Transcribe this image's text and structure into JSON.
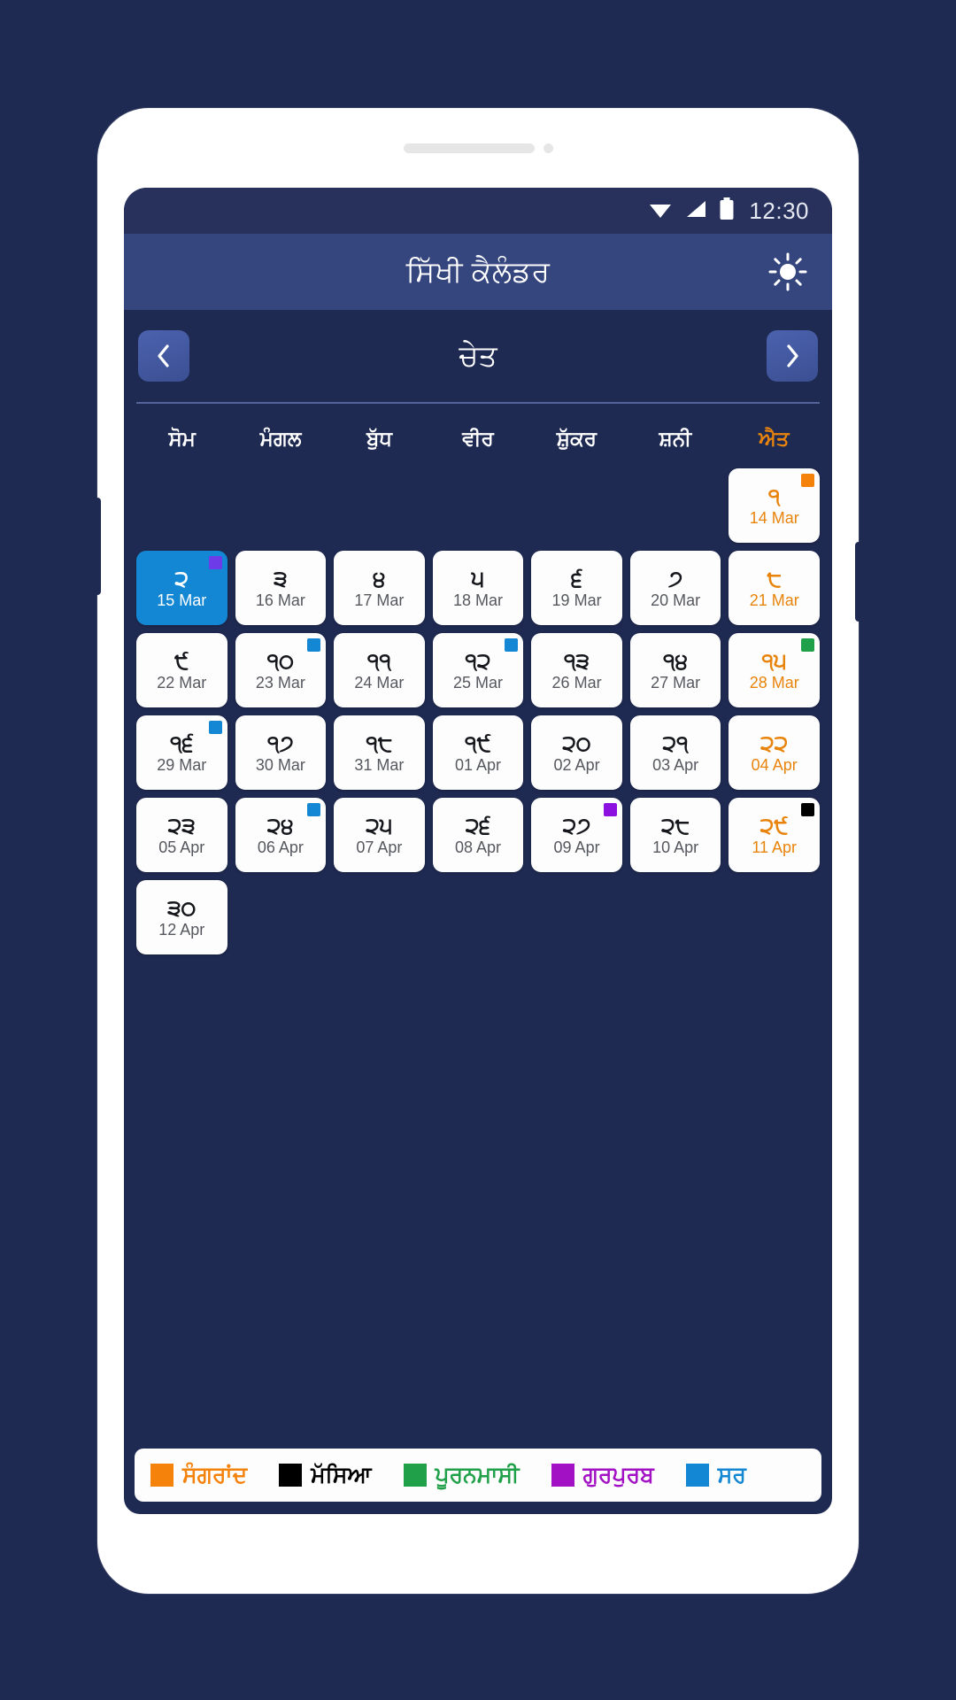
{
  "statusbar": {
    "time": "12:30",
    "icons": [
      "wifi-icon",
      "signal-icon",
      "battery-icon"
    ]
  },
  "appbar": {
    "title": "ਸਿੱਖੀ ਕੈਲੰਡਰ",
    "action_icon": "brightness-sun-icon"
  },
  "monthnav": {
    "prev_label": "‹",
    "next_label": "›",
    "month": "ਚੇਤ"
  },
  "weekdays": [
    {
      "label": "ਸੋਮ",
      "sunday": false
    },
    {
      "label": "ਮੰਗਲ",
      "sunday": false
    },
    {
      "label": "ਬੁੱਧ",
      "sunday": false
    },
    {
      "label": "ਵੀਰ",
      "sunday": false
    },
    {
      "label": "ਸ਼ੁੱਕਰ",
      "sunday": false
    },
    {
      "label": "ਸ਼ਨੀ",
      "sunday": false
    },
    {
      "label": "ਐਤ",
      "sunday": true
    }
  ],
  "colors": {
    "sangrand": "#F5820B",
    "massia": "#000000",
    "puranmashi": "#21A04A",
    "gurpurab": "#A211C4",
    "other": "#1387D3",
    "selected": "#1387D3",
    "screen_bg": "#1F2A52",
    "appbar_bg": "#35467F",
    "statusbar_bg": "#27315C"
  },
  "calendar": {
    "leading_blanks": 6,
    "days": [
      {
        "num": "੧",
        "sub": "14 Mar",
        "sunday": true,
        "selected": false,
        "badge": "#F5820B"
      },
      {
        "num": "੨",
        "sub": "15 Mar",
        "sunday": false,
        "selected": true,
        "badge": "#6E3BE8"
      },
      {
        "num": "੩",
        "sub": "16 Mar",
        "sunday": false,
        "selected": false,
        "badge": null
      },
      {
        "num": "੪",
        "sub": "17 Mar",
        "sunday": false,
        "selected": false,
        "badge": null
      },
      {
        "num": "੫",
        "sub": "18 Mar",
        "sunday": false,
        "selected": false,
        "badge": null
      },
      {
        "num": "੬",
        "sub": "19 Mar",
        "sunday": false,
        "selected": false,
        "badge": null
      },
      {
        "num": "੭",
        "sub": "20 Mar",
        "sunday": false,
        "selected": false,
        "badge": null
      },
      {
        "num": "੮",
        "sub": "21 Mar",
        "sunday": true,
        "selected": false,
        "badge": null
      },
      {
        "num": "੯",
        "sub": "22 Mar",
        "sunday": false,
        "selected": false,
        "badge": null
      },
      {
        "num": "੧੦",
        "sub": "23 Mar",
        "sunday": false,
        "selected": false,
        "badge": "#1387D3"
      },
      {
        "num": "੧੧",
        "sub": "24 Mar",
        "sunday": false,
        "selected": false,
        "badge": null
      },
      {
        "num": "੧੨",
        "sub": "25 Mar",
        "sunday": false,
        "selected": false,
        "badge": "#1387D3"
      },
      {
        "num": "੧੩",
        "sub": "26 Mar",
        "sunday": false,
        "selected": false,
        "badge": null
      },
      {
        "num": "੧੪",
        "sub": "27 Mar",
        "sunday": false,
        "selected": false,
        "badge": null
      },
      {
        "num": "੧੫",
        "sub": "28 Mar",
        "sunday": true,
        "selected": false,
        "badge": "#21A04A"
      },
      {
        "num": "੧੬",
        "sub": "29 Mar",
        "sunday": false,
        "selected": false,
        "badge": "#1387D3"
      },
      {
        "num": "੧੭",
        "sub": "30 Mar",
        "sunday": false,
        "selected": false,
        "badge": null
      },
      {
        "num": "੧੮",
        "sub": "31 Mar",
        "sunday": false,
        "selected": false,
        "badge": null
      },
      {
        "num": "੧੯",
        "sub": "01 Apr",
        "sunday": false,
        "selected": false,
        "badge": null
      },
      {
        "num": "੨੦",
        "sub": "02 Apr",
        "sunday": false,
        "selected": false,
        "badge": null
      },
      {
        "num": "੨੧",
        "sub": "03 Apr",
        "sunday": false,
        "selected": false,
        "badge": null
      },
      {
        "num": "੨੨",
        "sub": "04 Apr",
        "sunday": true,
        "selected": false,
        "badge": null
      },
      {
        "num": "੨੩",
        "sub": "05 Apr",
        "sunday": false,
        "selected": false,
        "badge": null
      },
      {
        "num": "੨੪",
        "sub": "06 Apr",
        "sunday": false,
        "selected": false,
        "badge": "#1387D3"
      },
      {
        "num": "੨੫",
        "sub": "07 Apr",
        "sunday": false,
        "selected": false,
        "badge": null
      },
      {
        "num": "੨੬",
        "sub": "08 Apr",
        "sunday": false,
        "selected": false,
        "badge": null
      },
      {
        "num": "੨੭",
        "sub": "09 Apr",
        "sunday": false,
        "selected": false,
        "badge": "#8C11E0"
      },
      {
        "num": "੨੮",
        "sub": "10 Apr",
        "sunday": false,
        "selected": false,
        "badge": null
      },
      {
        "num": "੨੯",
        "sub": "11 Apr",
        "sunday": true,
        "selected": false,
        "badge": "#000000"
      },
      {
        "num": "੩੦",
        "sub": "12 Apr",
        "sunday": false,
        "selected": false,
        "badge": null
      }
    ]
  },
  "legend": [
    {
      "label": "ਸੰਗਰਾਂਦ",
      "color": "#F5820B"
    },
    {
      "label": "ਮੱਸਿਆ",
      "color": "#000000"
    },
    {
      "label": "ਪੂਰਨਮਾਸੀ",
      "color": "#21A04A"
    },
    {
      "label": "ਗੁਰਪੁਰਬ",
      "color": "#A211C4"
    },
    {
      "label": "ਸਰ",
      "color": "#1387D3"
    }
  ]
}
